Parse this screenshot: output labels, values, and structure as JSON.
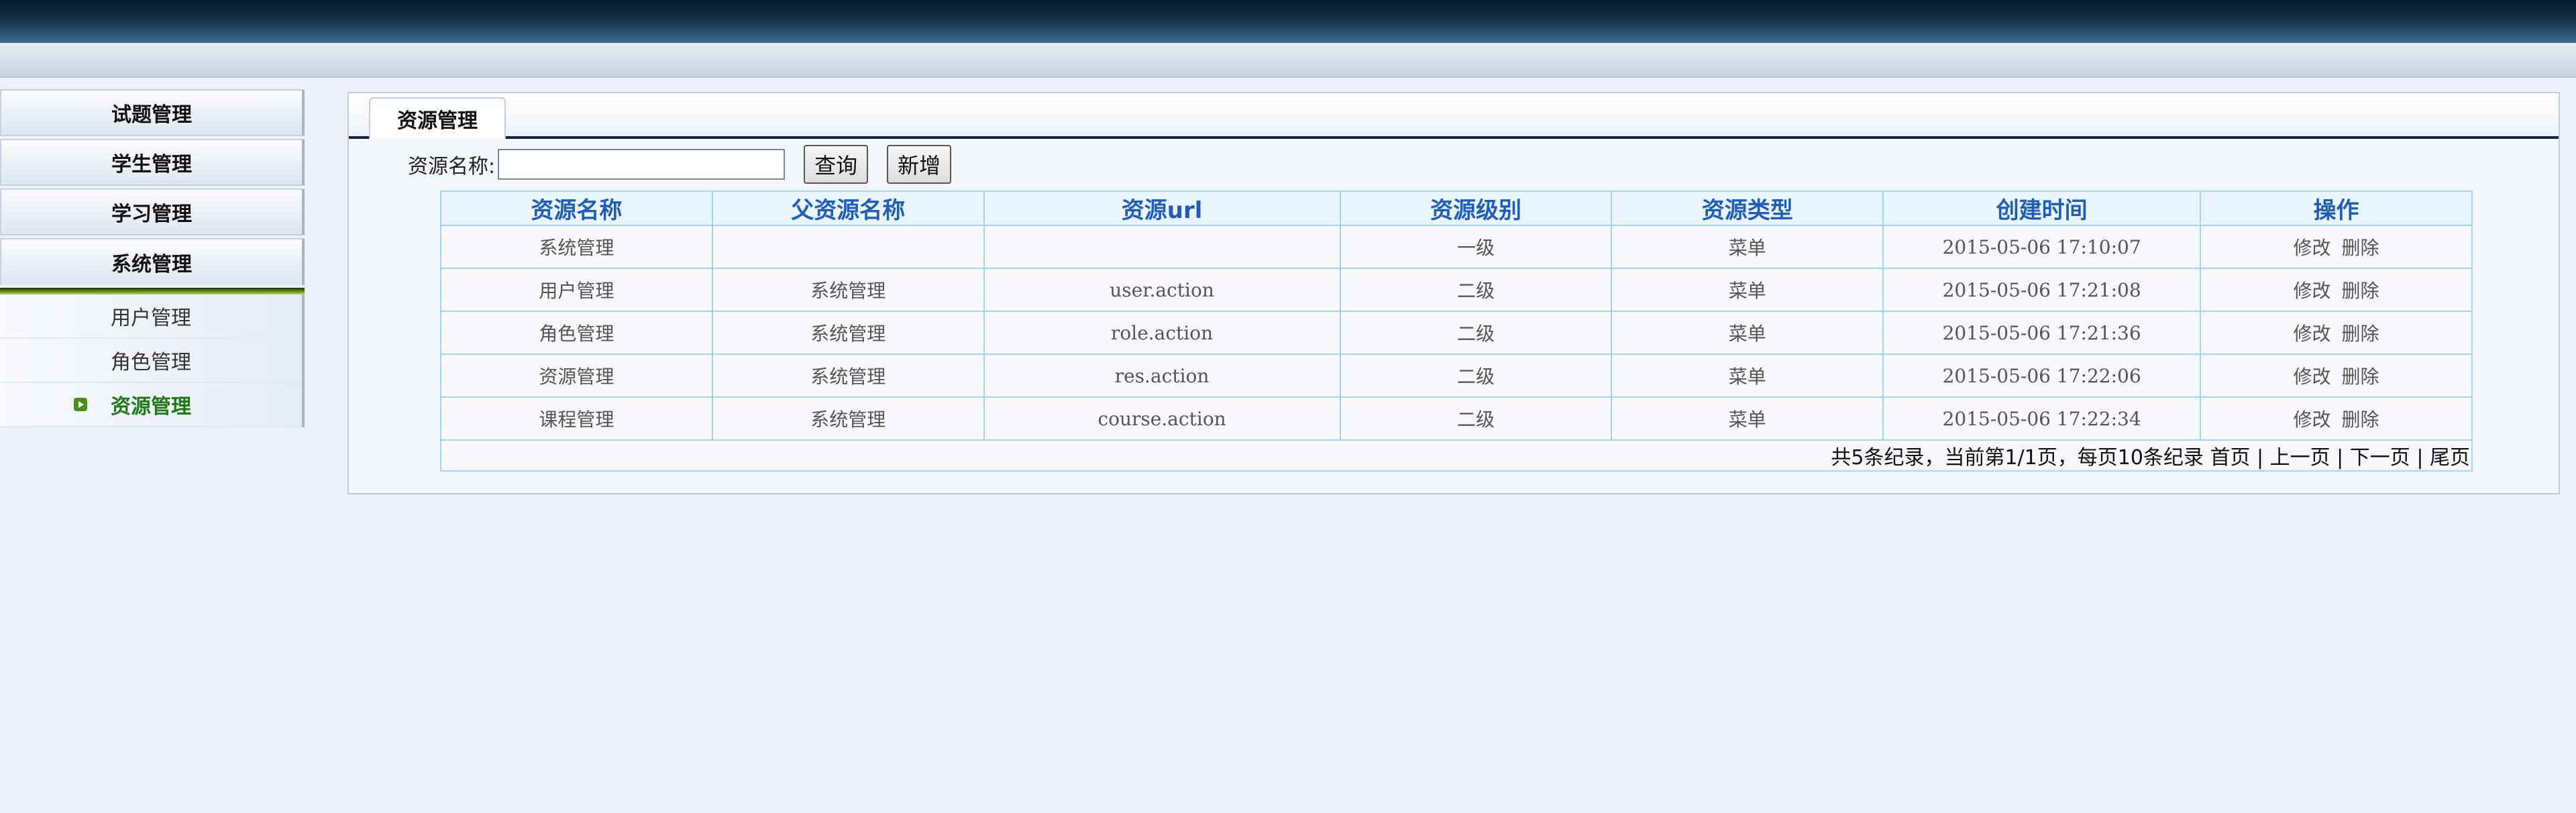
{
  "sidebar": {
    "menus": [
      "试题管理",
      "学生管理",
      "学习管理",
      "系统管理"
    ],
    "submenu": [
      "用户管理",
      "角色管理",
      "资源管理"
    ],
    "current": "资源管理"
  },
  "panel": {
    "tab_label": "资源管理",
    "search_label": "资源名称:",
    "search_value": "",
    "query_button": "查询",
    "add_button": "新增"
  },
  "table": {
    "headers": [
      "资源名称",
      "父资源名称",
      "资源url",
      "资源级别",
      "资源类型",
      "创建时间",
      "操作"
    ],
    "rows": [
      {
        "name": "系统管理",
        "parent": "",
        "url": "",
        "level": "一级",
        "type": "菜单",
        "created": "2015-05-06 17:10:07",
        "edit": "修改",
        "del": "删除"
      },
      {
        "name": "用户管理",
        "parent": "系统管理",
        "url": "user.action",
        "level": "二级",
        "type": "菜单",
        "created": "2015-05-06 17:21:08",
        "edit": "修改",
        "del": "删除"
      },
      {
        "name": "角色管理",
        "parent": "系统管理",
        "url": "role.action",
        "level": "二级",
        "type": "菜单",
        "created": "2015-05-06 17:21:36",
        "edit": "修改",
        "del": "删除"
      },
      {
        "name": "资源管理",
        "parent": "系统管理",
        "url": "res.action",
        "level": "二级",
        "type": "菜单",
        "created": "2015-05-06 17:22:06",
        "edit": "修改",
        "del": "删除"
      },
      {
        "name": "课程管理",
        "parent": "系统管理",
        "url": "course.action",
        "level": "二级",
        "type": "菜单",
        "created": "2015-05-06 17:22:34",
        "edit": "修改",
        "del": "删除"
      }
    ],
    "pager": "共5条纪录，当前第1/1页，每页10条纪录 首页 | 上一页 | 下一页 | 尾页"
  },
  "colors": {
    "header_text": "#1f5db8",
    "grid_border": "#a8d4ec",
    "active_submenu": "#1d7a17",
    "banner": "#13304a"
  }
}
